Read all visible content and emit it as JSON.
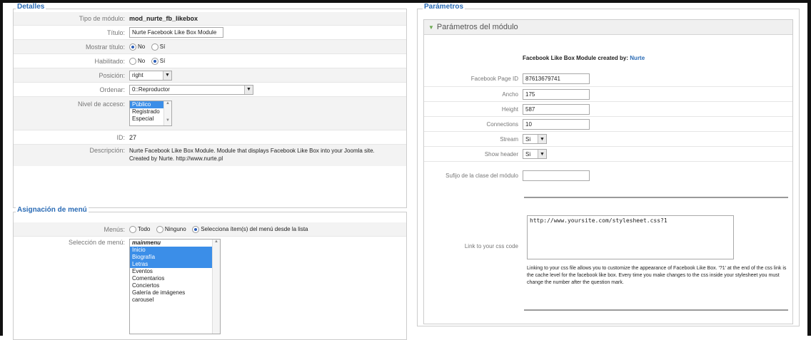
{
  "details": {
    "legend": "Detalles",
    "module_type": {
      "label": "Tipo de módulo:",
      "value": "mod_nurte_fb_likebox"
    },
    "title": {
      "label": "Título:",
      "value": "Nurte Facebook Like Box Module"
    },
    "show_title": {
      "label": "Mostrar título:",
      "opt_no": "No",
      "opt_yes": "Sí",
      "selected": "No"
    },
    "enabled": {
      "label": "Habilitado:",
      "opt_no": "No",
      "opt_yes": "Sí",
      "selected": "Sí"
    },
    "position": {
      "label": "Posición:",
      "value": "right"
    },
    "order": {
      "label": "Ordenar:",
      "value": "0::Reproductor"
    },
    "access": {
      "label": "Nivel de acceso:",
      "options": [
        "Público",
        "Registrado",
        "Especial"
      ],
      "selected": "Público"
    },
    "id": {
      "label": "ID:",
      "value": "27"
    },
    "description": {
      "label": "Descripción:",
      "value": "Nurte Facebook Like Box Module. Module that displays Facebook Like Box into your Joomla site. Created by Nurte. http://www.nurte.pl"
    }
  },
  "menu_assignment": {
    "legend": "Asignación de menú",
    "menus": {
      "label": "Menús:",
      "opt_all": "Todo",
      "opt_none": "Ninguno",
      "opt_select": "Selecciona ítem(s) del menú desde la lista",
      "selected": "select"
    },
    "selection": {
      "label": "Selección de menú:",
      "header": "mainmenu",
      "items": [
        {
          "label": "Inicio",
          "selected": true
        },
        {
          "label": "Biografía",
          "selected": true
        },
        {
          "label": "Letras",
          "selected": true
        },
        {
          "label": "Eventos",
          "selected": false
        },
        {
          "label": "Comentarios",
          "selected": false
        },
        {
          "label": "Conciertos",
          "selected": false
        },
        {
          "label": "Galería de imágenes",
          "selected": false
        },
        {
          "label": "carousel",
          "selected": false
        }
      ]
    }
  },
  "params": {
    "legend": "Parámetros",
    "section_title": "Parámetros del módulo",
    "credit_text": "Facebook Like Box Module created by:",
    "credit_link": "Nurte",
    "page_id": {
      "label": "Facebook Page ID",
      "value": "87613679741"
    },
    "width": {
      "label": "Ancho",
      "value": "175"
    },
    "height": {
      "label": "Height",
      "value": "587"
    },
    "connections": {
      "label": "Connections",
      "value": "10"
    },
    "stream": {
      "label": "Stream",
      "value": "Si"
    },
    "show_header": {
      "label": "Show header",
      "value": "Si"
    },
    "suffix": {
      "label": "Sufijo de la clase del módulo",
      "value": ""
    },
    "css_link": {
      "label": "Link to your css code",
      "value": "http://www.yoursite.com/stylesheet.css?1"
    },
    "css_help": "Linking to your css file allows you to customize the appearance of Facebook Like Box. '?1' at the end of the css link is the cache level for the facebook like box. Every time you make changes to the css inside your stylesheet you must change the number after the question mark."
  },
  "colors": {
    "legend": "#2a6bb5",
    "selection": "#3b8ee8",
    "frame": "#111111"
  }
}
